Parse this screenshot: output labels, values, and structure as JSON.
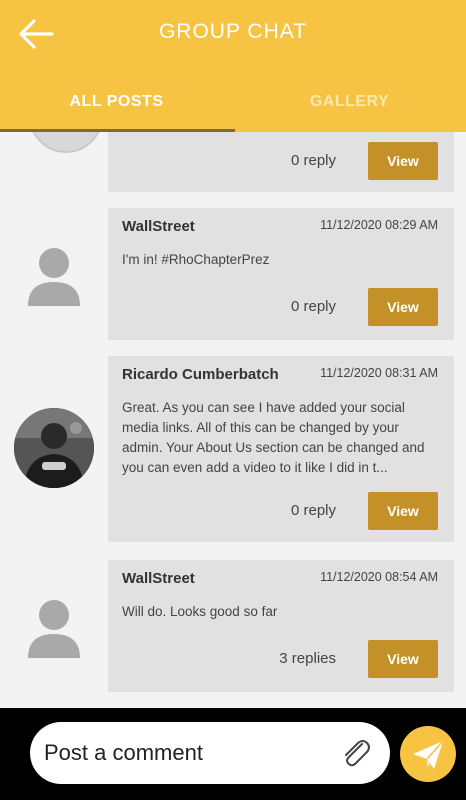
{
  "header": {
    "title": "GROUP CHAT",
    "tabs": [
      {
        "label": "ALL POSTS",
        "active": true
      },
      {
        "label": "GALLERY",
        "active": false
      }
    ]
  },
  "posts": [
    {
      "author": "",
      "time": "",
      "text": "",
      "reply": "0 reply",
      "view": "View"
    },
    {
      "author": "WallStreet",
      "time": "11/12/2020 08:29 AM",
      "text": "I'm in! #RhoChapterPrez",
      "reply": "0 reply",
      "view": "View"
    },
    {
      "author": "Ricardo Cumberbatch",
      "time": "11/12/2020 08:31 AM",
      "text": "Great. As you can see I have added your social media links. All of this can be changed by your admin. Your About Us section can be changed and you can even add a video to it like I did in t...",
      "reply": "0 reply",
      "view": "View"
    },
    {
      "author": "WallStreet",
      "time": "11/12/2020 08:54 AM",
      "text": "Will do. Looks good so far",
      "reply": "3 replies",
      "view": "View"
    }
  ],
  "composer": {
    "placeholder": "Post a comment"
  },
  "icons": {
    "back": "arrow-left-icon",
    "attach": "paperclip-icon",
    "send": "paper-plane-icon",
    "avatar": "user-silhouette-icon"
  },
  "colors": {
    "header": "#f7c342",
    "view_button": "#c39128",
    "card": "#e1e1e1"
  }
}
